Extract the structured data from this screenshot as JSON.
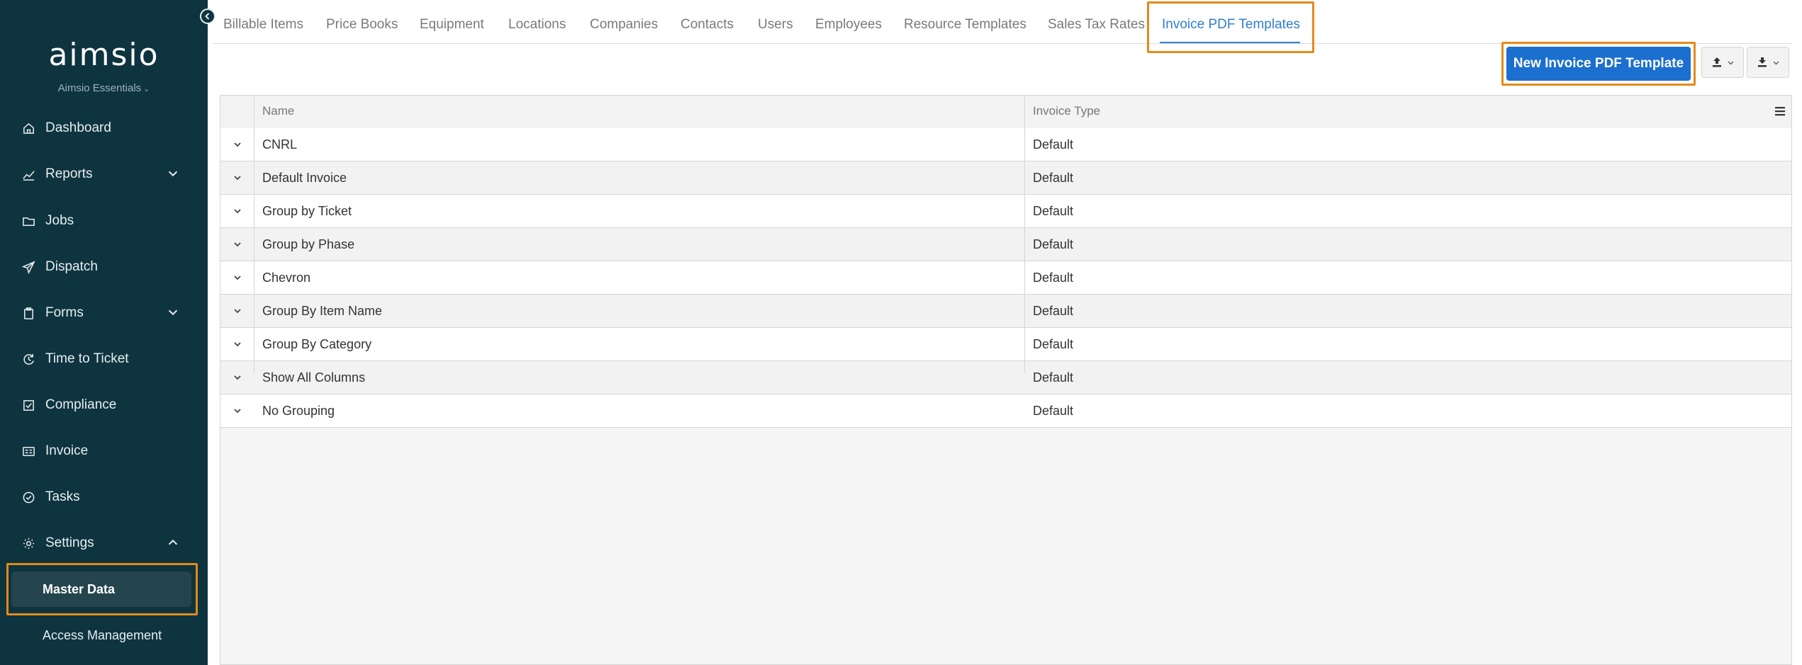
{
  "app": {
    "logo_text": "aimsio",
    "edition": "Aimsio Essentials"
  },
  "sidebar": {
    "items": [
      {
        "label": "Dashboard",
        "icon": "home-icon"
      },
      {
        "label": "Reports",
        "icon": "chart-icon",
        "expandable": true
      },
      {
        "label": "Jobs",
        "icon": "folder-icon"
      },
      {
        "label": "Dispatch",
        "icon": "paper-plane-icon"
      },
      {
        "label": "Forms",
        "icon": "clipboard-icon",
        "expandable": true
      },
      {
        "label": "Time to Ticket",
        "icon": "clock-arrow-icon"
      },
      {
        "label": "Compliance",
        "icon": "compliance-icon"
      },
      {
        "label": "Invoice",
        "icon": "invoice-icon"
      },
      {
        "label": "Tasks",
        "icon": "check-circle-icon"
      },
      {
        "label": "Settings",
        "icon": "gear-icon",
        "expanded": true
      }
    ],
    "sub_items": [
      {
        "label": "Master Data",
        "active": true
      },
      {
        "label": "Access Management",
        "active": false
      }
    ]
  },
  "tabs": [
    {
      "label": "Billable Items"
    },
    {
      "label": "Price Books"
    },
    {
      "label": "Equipment"
    },
    {
      "label": "Locations"
    },
    {
      "label": "Companies"
    },
    {
      "label": "Contacts"
    },
    {
      "label": "Users"
    },
    {
      "label": "Employees"
    },
    {
      "label": "Resource Templates"
    },
    {
      "label": "Sales Tax Rates"
    },
    {
      "label": "Invoice PDF Templates",
      "active": true
    }
  ],
  "toolbar": {
    "new_button_label": "New Invoice PDF Template",
    "upload_icon": "upload-icon",
    "download_icon": "download-icon"
  },
  "grid": {
    "columns": [
      "Name",
      "Invoice Type"
    ],
    "rows": [
      {
        "name": "CNRL",
        "invoice_type": "Default"
      },
      {
        "name": "Default Invoice",
        "invoice_type": "Default"
      },
      {
        "name": "Group by Ticket",
        "invoice_type": "Default"
      },
      {
        "name": "Group by Phase",
        "invoice_type": "Default"
      },
      {
        "name": "Chevron",
        "invoice_type": "Default"
      },
      {
        "name": "Group By Item Name",
        "invoice_type": "Default"
      },
      {
        "name": "Group By Category",
        "invoice_type": "Default"
      },
      {
        "name": "Show All Columns",
        "invoice_type": "Default"
      },
      {
        "name": "No Grouping",
        "invoice_type": "Default"
      }
    ]
  },
  "colors": {
    "sidebar_bg": "#0e3440",
    "accent": "#2f7fd0",
    "primary_button": "#1b6fce",
    "highlight": "#e38a1a"
  }
}
